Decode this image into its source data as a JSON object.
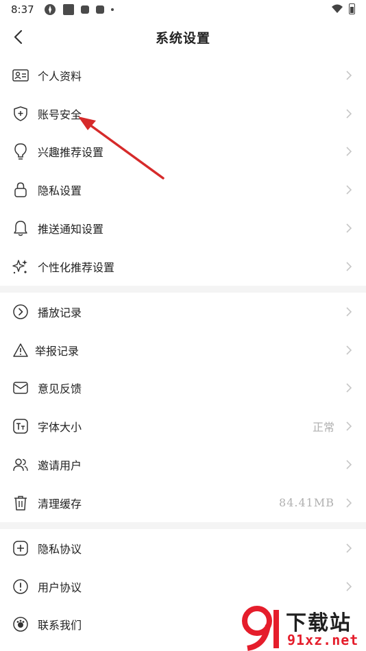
{
  "status_bar": {
    "time": "8:37"
  },
  "header": {
    "title": "系统设置"
  },
  "groups": [
    {
      "items": [
        {
          "label": "个人资料",
          "icon": "id-card-icon"
        },
        {
          "label": "账号安全",
          "icon": "shield-plus-icon"
        },
        {
          "label": "兴趣推荐设置",
          "icon": "lightbulb-icon"
        },
        {
          "label": "隐私设置",
          "icon": "lock-icon"
        },
        {
          "label": "推送通知设置",
          "icon": "bell-icon"
        },
        {
          "label": "个性化推荐设置",
          "icon": "sparkle-icon"
        }
      ]
    },
    {
      "items": [
        {
          "label": "播放记录",
          "icon": "play-circle-icon"
        },
        {
          "label": "举报记录",
          "icon": "warning-triangle-icon"
        },
        {
          "label": "意见反馈",
          "icon": "envelope-icon"
        },
        {
          "label": "字体大小",
          "icon": "font-size-icon",
          "value": "正常"
        },
        {
          "label": "邀请用户",
          "icon": "users-icon"
        },
        {
          "label": "清理缓存",
          "icon": "trash-icon",
          "value": "84.41MB"
        }
      ]
    },
    {
      "items": [
        {
          "label": "隐私协议",
          "icon": "plus-square-icon"
        },
        {
          "label": "用户协议",
          "icon": "exclamation-circle-icon"
        },
        {
          "label": "联系我们",
          "icon": "contact-icon"
        }
      ]
    }
  ],
  "watermark": {
    "text_cn": "下载站",
    "text_url": "91xz.net"
  },
  "colors": {
    "annotation_arrow": "#d62a2a",
    "divider": "#f4f4f4",
    "chevron": "#c6c6c6",
    "value_text": "#b0b0b0"
  }
}
